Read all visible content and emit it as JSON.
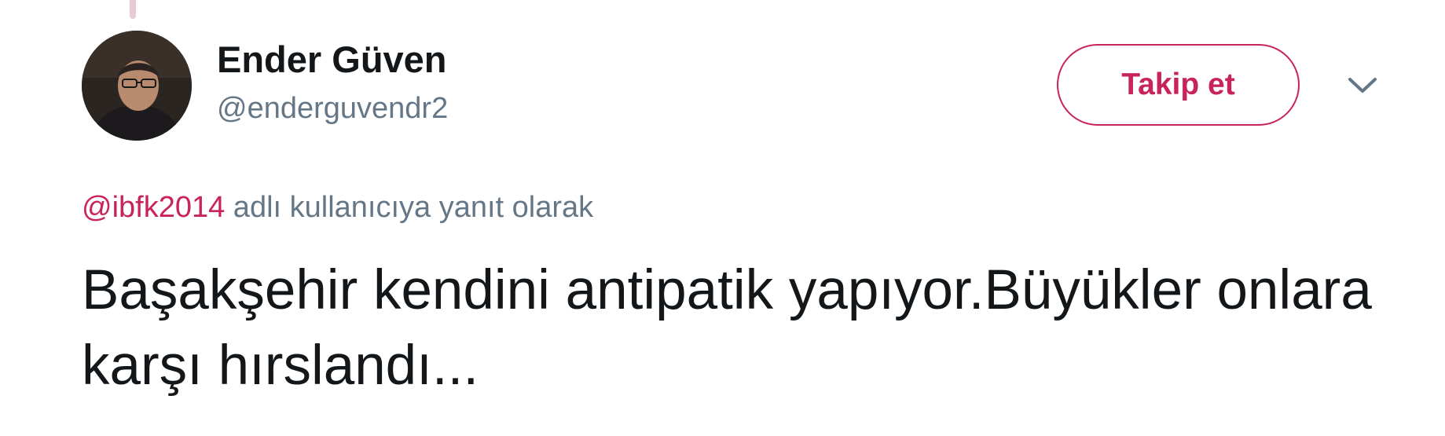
{
  "author": {
    "display_name": "Ender Güven",
    "handle": "@enderguvendr2",
    "avatar_icon": "profile-photo"
  },
  "follow_button": {
    "label": "Takip et"
  },
  "menu": {
    "icon": "chevron-down-icon"
  },
  "reply_context": {
    "mention": "@ibfk2014",
    "text": " adlı kullanıcıya yanıt olarak"
  },
  "tweet": {
    "text": "Başakşehir kendini antipatik yapıyor.Büyükler onlara karşı hırslandı..."
  },
  "colors": {
    "accent": "#c8245a",
    "secondary_text": "#657786",
    "primary_text": "#14171a"
  }
}
